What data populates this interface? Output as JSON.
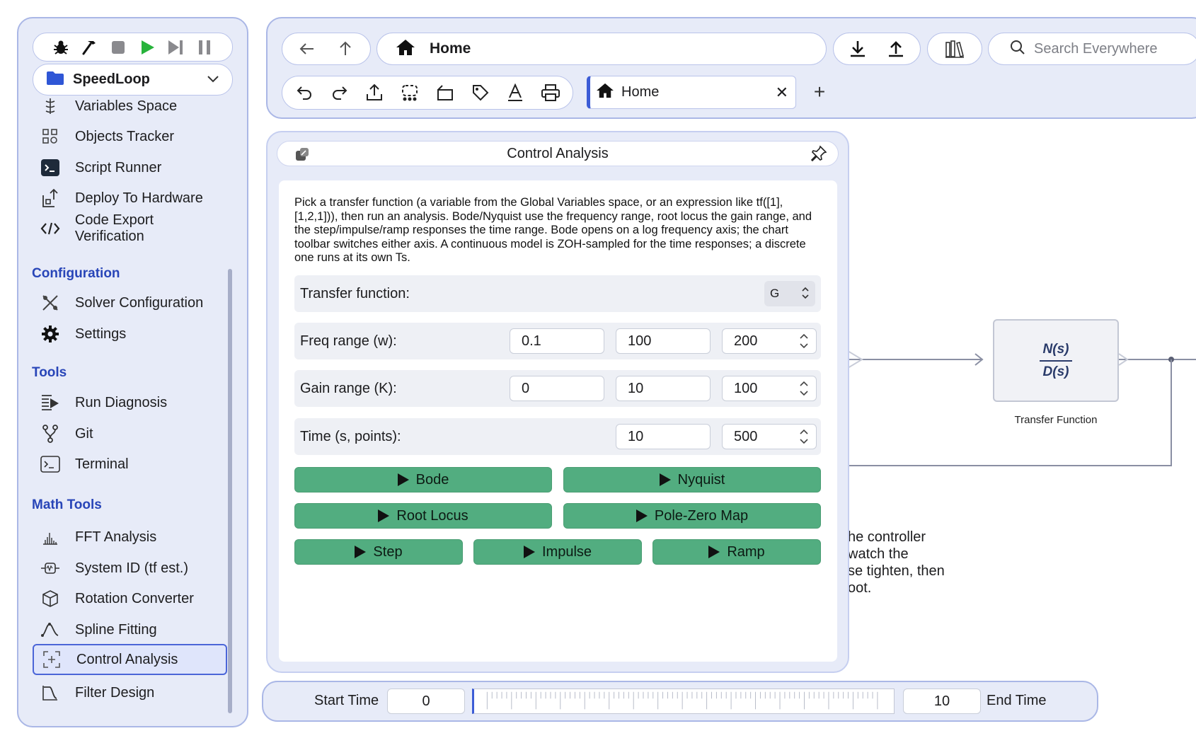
{
  "sidebar": {
    "project": "SpeedLoop",
    "top_items": [
      {
        "label": "Variables Space",
        "icon": "variables-icon"
      },
      {
        "label": "Objects Tracker",
        "icon": "objects-tracker-icon"
      },
      {
        "label": "Script Runner",
        "icon": "script-runner-icon"
      },
      {
        "label": "Deploy To Hardware",
        "icon": "deploy-icon"
      },
      {
        "label": "Code Export Verification",
        "icon": "code-export-icon"
      }
    ],
    "sections": {
      "configuration": "Configuration",
      "tools": "Tools",
      "math_tools": "Math Tools"
    },
    "configuration_items": [
      {
        "label": "Solver Configuration",
        "icon": "solver-icon"
      },
      {
        "label": "Settings",
        "icon": "gear-icon"
      }
    ],
    "tools_items": [
      {
        "label": "Run Diagnosis",
        "icon": "run-diagnosis-icon"
      },
      {
        "label": "Git",
        "icon": "git-branch-icon"
      },
      {
        "label": "Terminal",
        "icon": "terminal-icon"
      }
    ],
    "math_items": [
      {
        "label": "FFT Analysis",
        "icon": "fft-icon"
      },
      {
        "label": "System ID (tf est.)",
        "icon": "system-id-icon"
      },
      {
        "label": "Rotation Converter",
        "icon": "cube-icon"
      },
      {
        "label": "Spline Fitting",
        "icon": "spline-icon"
      },
      {
        "label": "Control Analysis",
        "icon": "control-analysis-icon",
        "active": true
      },
      {
        "label": "Filter Design",
        "icon": "filter-icon"
      }
    ]
  },
  "topbar": {
    "address": "Home",
    "search_placeholder": "Search Everywhere",
    "tab_label": "Home",
    "tab_add": "+"
  },
  "panel": {
    "title": "Control Analysis",
    "description": "Pick a transfer function (a variable from the Global Variables space, or an expression like tf([1],[1,2,1])), then run an analysis. Bode/Nyquist use the frequency range, root locus the gain range, and the step/impulse/ramp responses the time range. Bode opens on a log frequency axis; the chart toolbar switches either axis. A continuous model is ZOH-sampled for the time responses; a discrete one runs at its own Ts.",
    "tf_label": "Transfer function:",
    "tf_value": "G",
    "freq_label": "Freq range (w):",
    "freq_min": "0.1",
    "freq_max": "100",
    "freq_points": "200",
    "gain_label": "Gain range (K):",
    "gain_min": "0",
    "gain_max": "10",
    "gain_points": "100",
    "time_label": "Time (s, points):",
    "time_end": "10",
    "time_points": "500",
    "buttons": {
      "bode": "Bode",
      "nyquist": "Nyquist",
      "root_locus": "Root Locus",
      "pole_zero": "Pole-Zero Map",
      "step": "Step",
      "impulse": "Impulse",
      "ramp": "Ramp"
    }
  },
  "diagram": {
    "block_num": "N(s)",
    "block_den": "D(s)",
    "block_caption": "Transfer Function",
    "bg_text": [
      "he controller",
      " watch the",
      "se tighten, then",
      "oot."
    ]
  },
  "timeline": {
    "start_label": "Start Time",
    "start_value": "0",
    "end_value": "10",
    "end_label": "End Time"
  },
  "colors": {
    "accent": "#3c5cd6",
    "section": "#2845b8",
    "button_green": "#52ad80",
    "frame_bg": "#e7ebf8"
  }
}
